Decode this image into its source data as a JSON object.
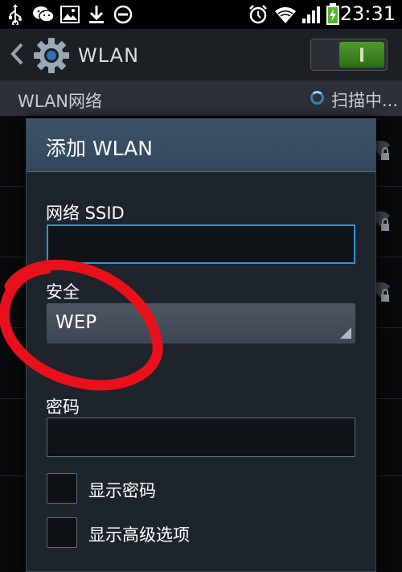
{
  "status_bar": {
    "time": "23:31",
    "left_icons": [
      "usb-icon",
      "wechat-icon",
      "image-icon",
      "download-icon",
      "do-not-disturb-icon"
    ],
    "right_icons": [
      "alarm-icon",
      "wifi-icon",
      "signal-icon",
      "battery-charging-icon"
    ]
  },
  "action_bar": {
    "title": "WLAN",
    "toggle_state": "on"
  },
  "section_header": {
    "label": "WLAN网络",
    "scan_status": "扫描中..."
  },
  "dialog": {
    "title": "添加 WLAN",
    "ssid_label": "网络 SSID",
    "ssid_value": "",
    "security_label": "安全",
    "security_value": "WEP",
    "password_label": "密码",
    "password_value": "",
    "show_password_label": "显示密码",
    "show_advanced_label": "显示高级选项"
  },
  "colors": {
    "accent_blue": "#3592d6",
    "toggle_green": "#4f9a2f",
    "annotation_red": "#e8101a",
    "dialog_title_bg": "#3d5268"
  }
}
